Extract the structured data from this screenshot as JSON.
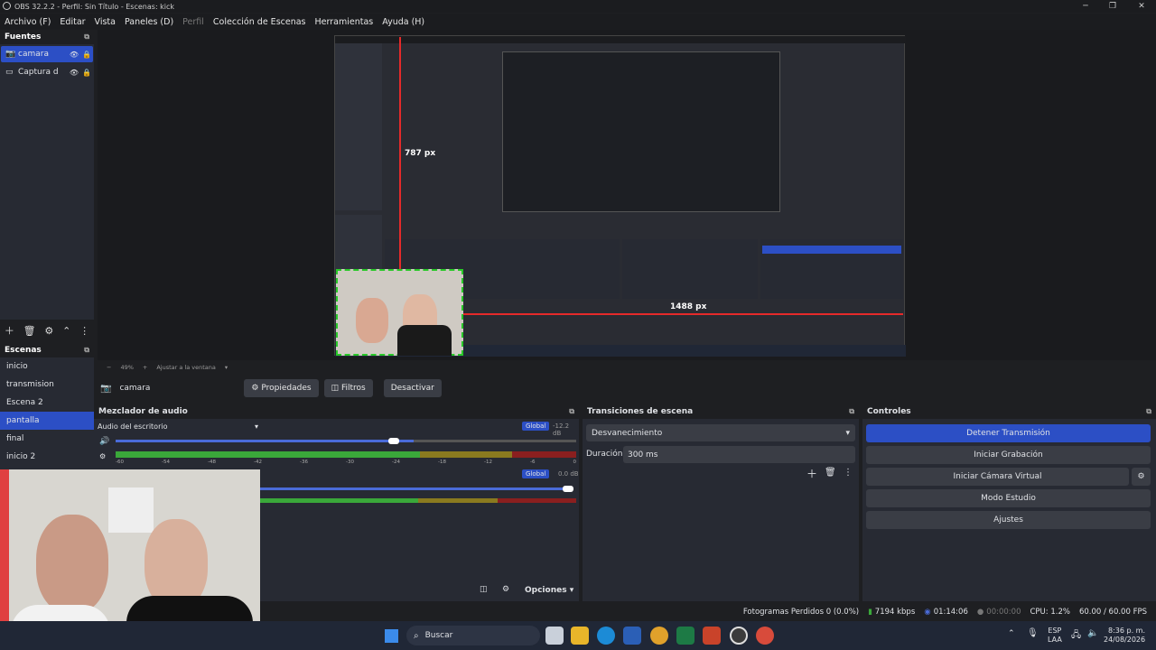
{
  "window": {
    "title": "OBS 32.2.2 - Perfil: Sin Título - Escenas: kick"
  },
  "menu": [
    "Archivo (F)",
    "Editar",
    "Vista",
    "Paneles (D)",
    "Perfil",
    "Colección de Escenas",
    "Herramientas",
    "Ayuda (H)"
  ],
  "sources": {
    "title": "Fuentes",
    "items": [
      {
        "name": "camara",
        "selected": true
      },
      {
        "name": "Captura d",
        "selected": false
      }
    ]
  },
  "scenes": {
    "title": "Escenas",
    "items": [
      "inicio",
      "transmision",
      "Escena 2",
      "pantalla",
      "final",
      "inicio 2"
    ],
    "selected": "pantalla"
  },
  "preview": {
    "label_vertical": "787 px",
    "label_horizontal": "1488 px",
    "zoom": "49%",
    "fit": "Ajustar a la ventana"
  },
  "source_toolbar": {
    "source": "camara",
    "props": "Propiedades",
    "filters": "Filtros",
    "deactivate": "Desactivar"
  },
  "mixer": {
    "title": "Mezclador de audio",
    "track1": {
      "name": "Audio del escritorio",
      "badge": "Global",
      "db": "-12.2 dB",
      "level": 0.6
    },
    "track2": {
      "badge": "Global",
      "db": "0.0 dB",
      "level": 1.0
    },
    "scale": [
      "-60",
      "-54",
      "-48",
      "-42",
      "-36",
      "-30",
      "-24",
      "-18",
      "-12",
      "-6",
      "0"
    ],
    "options": "Opciones"
  },
  "transitions": {
    "title": "Transiciones de escena",
    "type": "Desvanecimiento",
    "duration_label": "Duración",
    "duration": "300 ms"
  },
  "controls": {
    "title": "Controles",
    "stop": "Detener Transmisión",
    "record": "Iniciar Grabación",
    "virtual": "Iniciar Cámara Virtual",
    "studio": "Modo Estudio",
    "settings": "Ajustes"
  },
  "status": {
    "dropped": "Fotogramas Perdidos 0 (0.0%)",
    "kbps": "7194 kbps",
    "stream_time": "01:14:06",
    "rec_time": "00:00:00",
    "cpu": "CPU: 1.2%",
    "fps": "60.00 / 60.00 FPS"
  },
  "taskbar": {
    "search": "Buscar",
    "lang1": "ESP",
    "lang2": "LAA",
    "time": "8:36 p. m.",
    "date": "24/08/2026"
  },
  "colors": {
    "accent": "#2c4fc5",
    "panel": "#272a33",
    "bg": "#1e1f22"
  }
}
